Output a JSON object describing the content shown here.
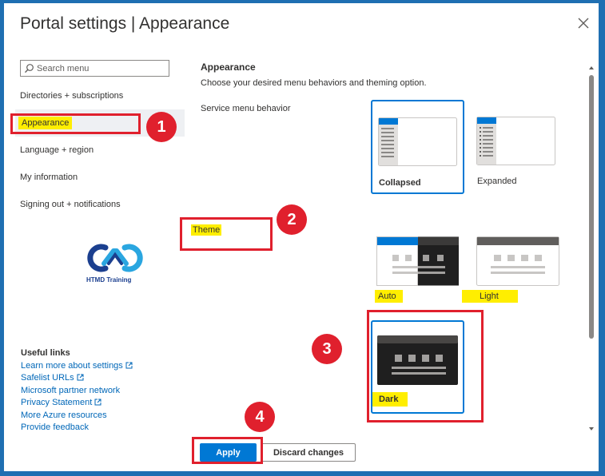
{
  "window": {
    "title": "Portal settings | Appearance"
  },
  "search": {
    "placeholder": "Search menu"
  },
  "sidebar": {
    "items": [
      {
        "label": "Directories + subscriptions"
      },
      {
        "label": "Appearance",
        "selected": true
      },
      {
        "label": "Language + region"
      },
      {
        "label": "My information"
      },
      {
        "label": "Signing out + notifications"
      }
    ]
  },
  "logo": {
    "text": "HTMD Training"
  },
  "useful_links": {
    "heading": "Useful links",
    "links": [
      {
        "label": "Learn more about settings",
        "external": true
      },
      {
        "label": "Safelist URLs",
        "external": true
      },
      {
        "label": "Microsoft partner network",
        "external": false
      },
      {
        "label": "Privacy Statement",
        "external": true
      },
      {
        "label": "More Azure resources",
        "external": false
      },
      {
        "label": "Provide feedback",
        "external": false
      }
    ]
  },
  "appearance": {
    "heading": "Appearance",
    "description": "Choose your desired menu behaviors and theming option.",
    "service_menu_label": "Service menu behavior",
    "service_menu_options": [
      {
        "label": "Collapsed",
        "selected": true
      },
      {
        "label": "Expanded",
        "selected": false
      }
    ],
    "theme_label": "Theme",
    "theme_options": [
      {
        "label": "Auto",
        "selected": false
      },
      {
        "label": "Light",
        "selected": false
      },
      {
        "label": "Dark",
        "selected": true
      }
    ]
  },
  "callouts": [
    "1",
    "2",
    "3",
    "4"
  ],
  "buttons": {
    "apply": "Apply",
    "discard": "Discard changes"
  },
  "colors": {
    "accent": "#0078d4",
    "annotation_red": "#e0202d",
    "highlight": "#ffee00",
    "frame": "#1f6fb2"
  }
}
